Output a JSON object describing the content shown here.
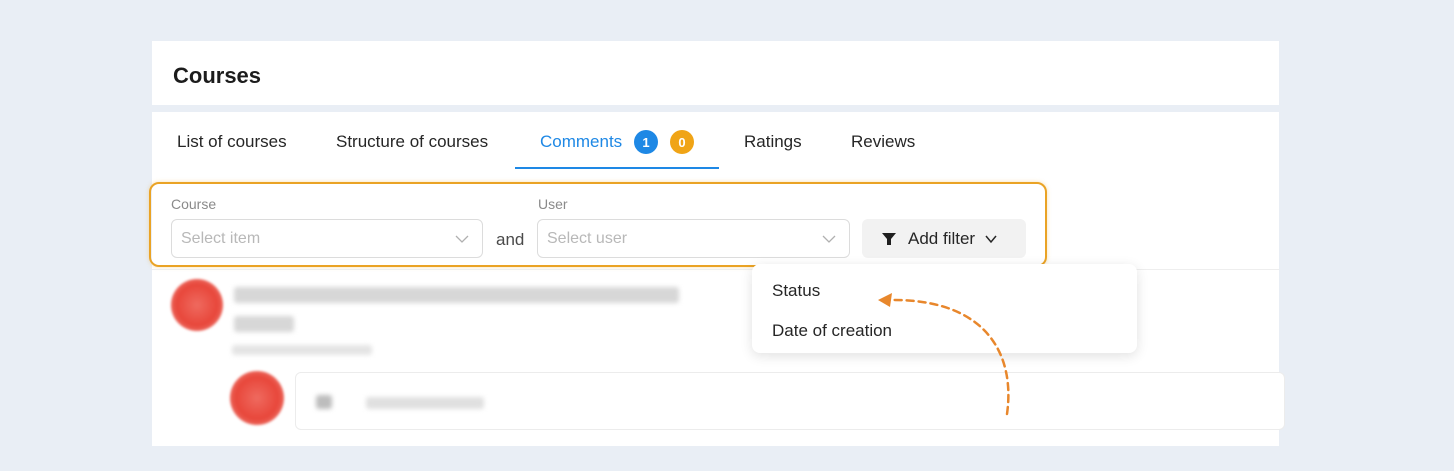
{
  "header": {
    "title": "Courses"
  },
  "tabs": [
    {
      "label": "List of courses",
      "active": false
    },
    {
      "label": "Structure of courses",
      "active": false
    },
    {
      "label": "Comments",
      "active": true,
      "badges": [
        "1",
        "0"
      ]
    },
    {
      "label": "Ratings",
      "active": false
    },
    {
      "label": "Reviews",
      "active": false
    }
  ],
  "filters": {
    "course": {
      "label": "Course",
      "placeholder": "Select item"
    },
    "conjunction": "and",
    "user": {
      "label": "User",
      "placeholder": "Select user"
    },
    "add_filter_label": "Add filter"
  },
  "dropdown": {
    "items": [
      "Status",
      "Date of creation"
    ]
  },
  "colors": {
    "accent": "#1e88e5",
    "badge_orange": "#f0a416",
    "highlight": "#eaa325",
    "arrow": "#e8872c"
  },
  "icons": {
    "filter": "funnel-icon",
    "chevron": "chevron-down-icon"
  }
}
